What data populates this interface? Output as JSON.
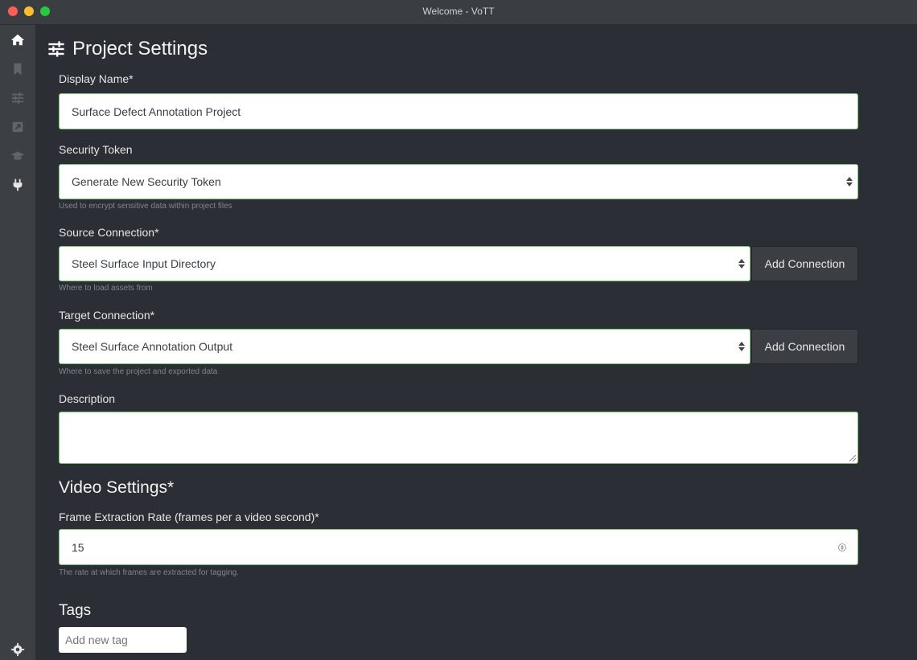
{
  "window": {
    "title": "Welcome - VoTT"
  },
  "sidebar": {
    "items": [
      {
        "icon": "home-icon",
        "active": true
      },
      {
        "icon": "bookmark-icon",
        "active": false
      },
      {
        "icon": "sliders-icon",
        "active": false
      },
      {
        "icon": "export-icon",
        "active": false
      },
      {
        "icon": "graduation-cap-icon",
        "active": false
      },
      {
        "icon": "plug-icon",
        "active": false
      }
    ],
    "settings_icon": "gear-icon"
  },
  "page": {
    "title": "Project Settings",
    "title_icon": "sliders-icon"
  },
  "form": {
    "display_name": {
      "label": "Display Name*",
      "value": "Surface Defect Annotation Project"
    },
    "security_token": {
      "label": "Security Token",
      "value": "Generate New Security Token",
      "hint": "Used to encrypt sensitive data within project files"
    },
    "source_connection": {
      "label": "Source Connection*",
      "value": "Steel Surface Input Directory",
      "hint": "Where to load assets from",
      "button": "Add Connection"
    },
    "target_connection": {
      "label": "Target Connection*",
      "value": "Steel Surface Annotation Output",
      "hint": "Where to save the project and exported data",
      "button": "Add Connection"
    },
    "description": {
      "label": "Description",
      "value": ""
    }
  },
  "video": {
    "heading": "Video Settings*",
    "frame_rate": {
      "label": "Frame Extraction Rate (frames per a video second)*",
      "value": "15",
      "hint": "The rate at which frames are extracted for tagging."
    }
  },
  "tags": {
    "heading": "Tags",
    "placeholder": "Add new tag"
  },
  "colors": {
    "accent_border": "#7cc576",
    "background": "#2b2e34",
    "sidebar": "#3c3f44"
  }
}
